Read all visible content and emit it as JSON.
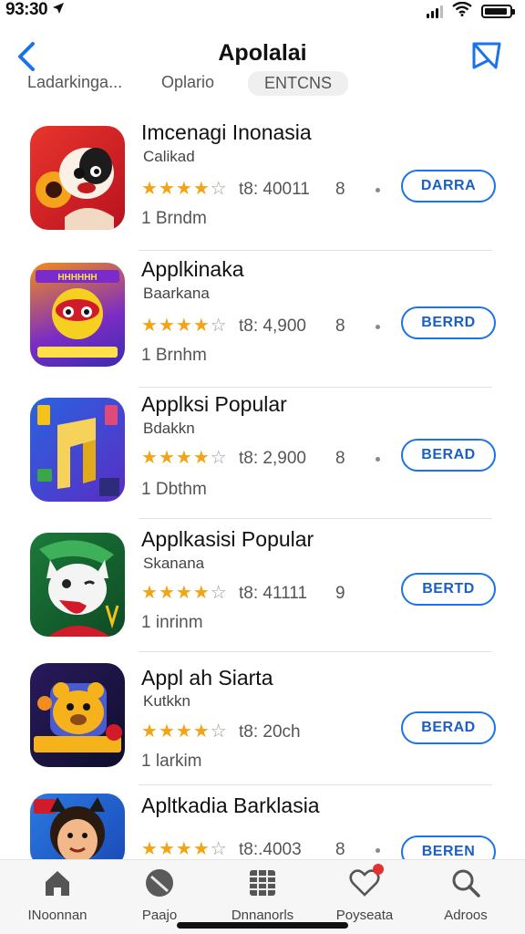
{
  "status": {
    "time": "93:30"
  },
  "header": {
    "title": "Apolalai"
  },
  "tabs": [
    {
      "label": "Ladarkinga..."
    },
    {
      "label": "Oplario"
    },
    {
      "label": "ENTCNS"
    }
  ],
  "apps": [
    {
      "name": "Imcenagi Inonasia",
      "subtitle": "Calikad",
      "rating": 3.5,
      "rating_text": "t8: 40011",
      "rank": "8",
      "button": "DARRA",
      "size": "1 Brndm"
    },
    {
      "name": "Applkinaka",
      "subtitle": "Baarkana",
      "rating": 3.5,
      "rating_text": "t8: 4,900",
      "rank": "8",
      "button": "BERRD",
      "size": "1 Brnhm"
    },
    {
      "name": "Applksi Popular",
      "subtitle": "Bdakkn",
      "rating": 3.5,
      "rating_text": "t8: 2,900",
      "rank": "8",
      "button": "BERAD",
      "size": "1 Dbthm"
    },
    {
      "name": "Applkasisi Popular",
      "subtitle": "Skanana",
      "rating": 3.5,
      "rating_text": "t8: 41111",
      "rank": "9",
      "button": "BERTD",
      "size": "1 inrinm"
    },
    {
      "name": "Appl ah Siarta",
      "subtitle": "Kutkkn",
      "rating": 3.5,
      "rating_text": "t8: 20ch",
      "rank": "",
      "button": "BERAD",
      "size": "1 larkim"
    },
    {
      "name": "Apltkadia Barklasia",
      "subtitle": "",
      "rating": 3.5,
      "rating_text": "t8:.4003",
      "rank": "8",
      "button": "BEREN",
      "size": ""
    }
  ],
  "bottom_tabs": [
    {
      "label": "INoonnan",
      "icon": "home-icon"
    },
    {
      "label": "Paajo",
      "icon": "pages-icon"
    },
    {
      "label": "Dnnanorls",
      "icon": "grid-icon"
    },
    {
      "label": "Poyseata",
      "icon": "heart-icon",
      "badge": true
    },
    {
      "label": "Adroos",
      "icon": "search-icon"
    }
  ],
  "colors": {
    "accent": "#1a73e8",
    "star": "#f2a416"
  }
}
